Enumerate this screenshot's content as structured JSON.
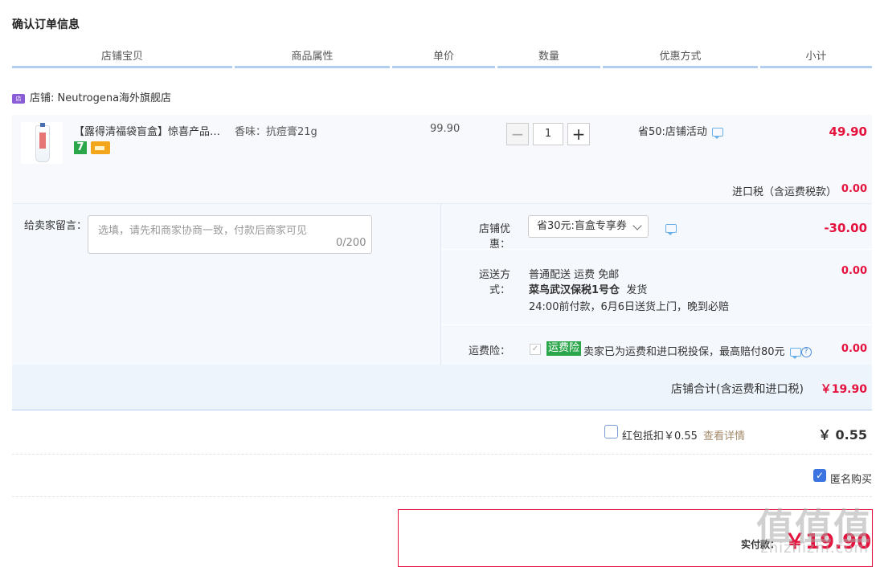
{
  "page": {
    "title": "确认订单信息"
  },
  "table_header": [
    "店铺宝贝",
    "商品属性",
    "单价",
    "数量",
    "优惠方式",
    "小计"
  ],
  "shop": {
    "name": "店铺: Neutrogena海外旗舰店",
    "icon": "shop-icon"
  },
  "item": {
    "name": "【露得清福袋盲盒】惊喜产品随机发货",
    "attribute": "香味：抗痘膏21g",
    "unit_price": "99.90",
    "quantity": "1",
    "promotion": "省50:店铺活动",
    "subtotal": "49.90",
    "badge_seven": "7"
  },
  "tax": {
    "label": "进口税（含运费税款）",
    "value": "0.00"
  },
  "message": {
    "label": "给卖家留言：",
    "placeholder": "选填，请先和商家协商一致，付款后商家可见",
    "counter": "0/200"
  },
  "coupon": {
    "label": "店铺优惠：",
    "selected": "省30元:盲盒专享券",
    "value": "-30.00"
  },
  "shipping": {
    "label": "运送方式：",
    "line1": "普通配送 运费 免邮",
    "line2_bold": "菜鸟武汉保税1号仓",
    "line2_rest": "发货",
    "line3": "24:00前付款，6月6日送货上门，晚到必赔",
    "value": "0.00"
  },
  "insurance": {
    "label": "运费险：",
    "badge": "运费险",
    "text": "卖家已为运费和进口税投保，最高赔付80元",
    "value": "0.00"
  },
  "shop_total": {
    "label": "店铺合计(含运费和进口税)",
    "value": "￥19.90"
  },
  "hongbao": {
    "text": "红包抵扣￥0.55",
    "link": "查看详情",
    "value": "￥ 0.55"
  },
  "anonymous": {
    "text": "匿名购买",
    "checked": true
  },
  "pay": {
    "label": "实付款：",
    "value": "￥19.90"
  },
  "watermark": {
    "big": "值值值",
    "small": "zhizhizhi.com"
  },
  "colors": {
    "price_red": "#e4123c",
    "accent_blue": "#b2cdf0",
    "green_badge": "#2ba64b"
  }
}
